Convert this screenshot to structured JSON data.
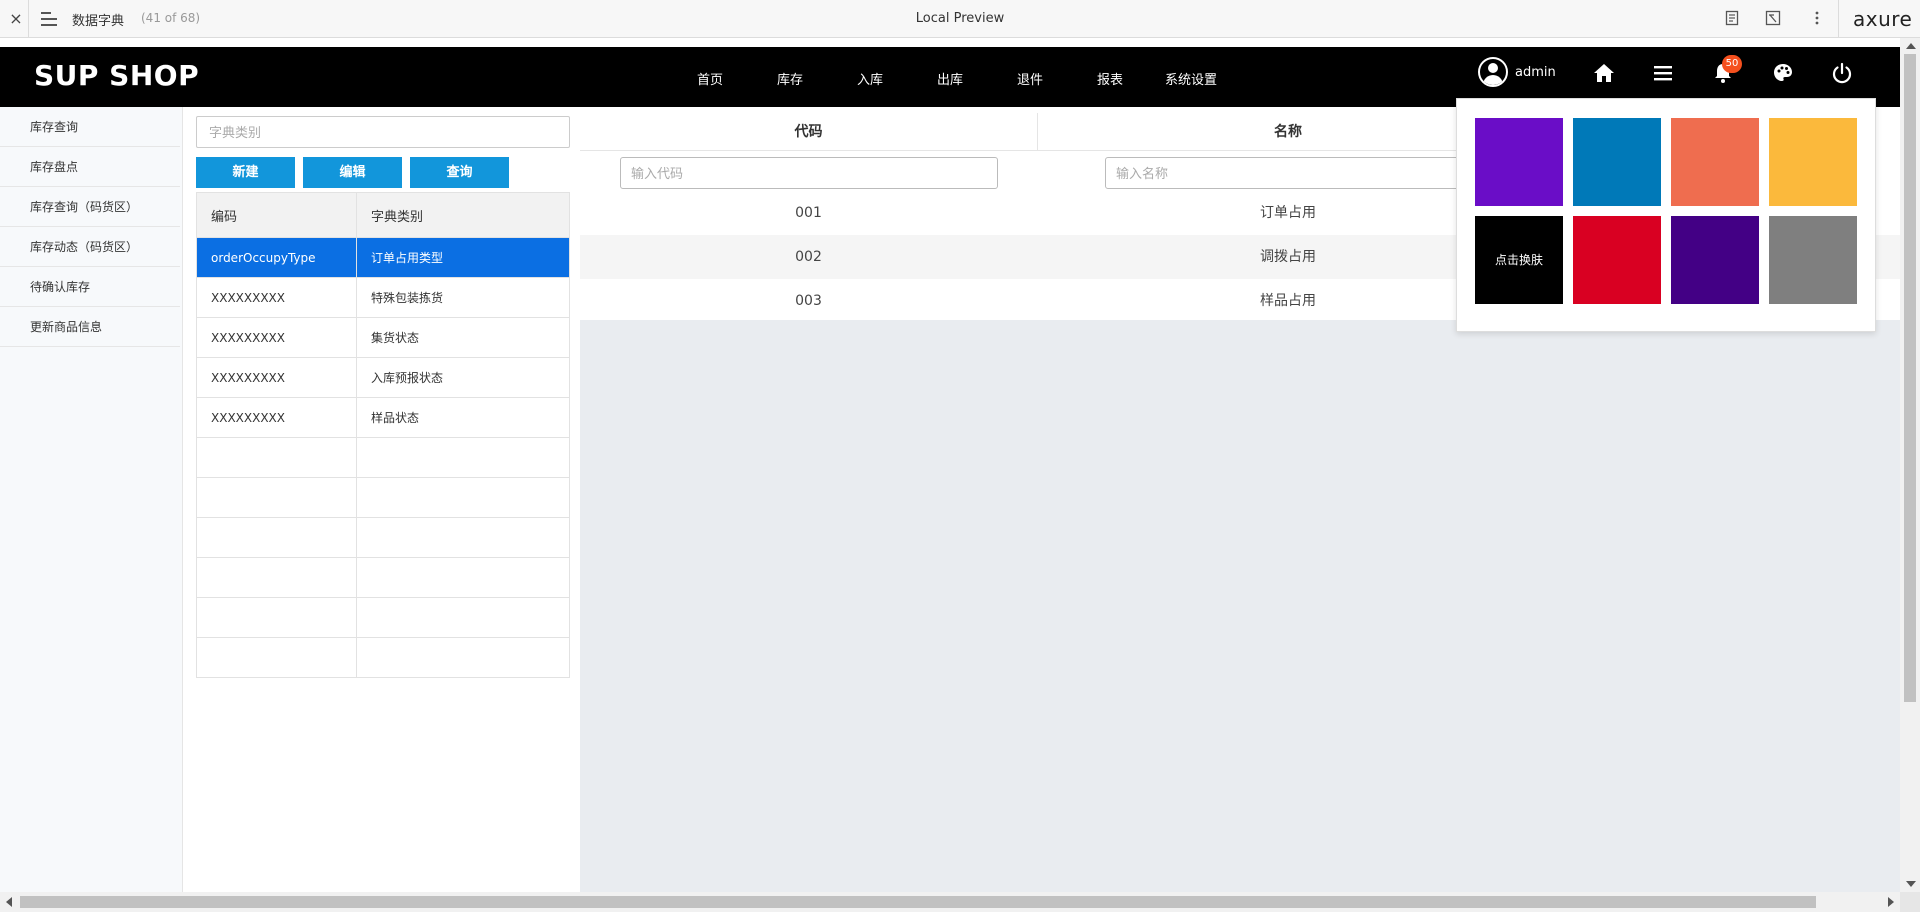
{
  "preview": {
    "close_glyph": "×",
    "page_name": "数据字典",
    "page_count": "(41 of 68)",
    "title": "Local Preview",
    "logo": "axure",
    "icons": [
      "notes-icon",
      "inspect-icon",
      "more-icon"
    ]
  },
  "header": {
    "logo": "SUP SHOP",
    "nav": [
      "首页",
      "库存",
      "入库",
      "出库",
      "退件",
      "报表",
      "系统设置"
    ],
    "user": "admin",
    "notification_count": "50",
    "badge_color": "#f5501e"
  },
  "sidebar": {
    "items": [
      "库存查询",
      "库存盘点",
      "库存查询（码货区）",
      "库存动态（码货区）",
      "待确认库存",
      "更新商品信息"
    ]
  },
  "category_panel": {
    "search_placeholder": "字典类别",
    "buttons": {
      "new": "新建",
      "edit": "编辑",
      "query": "查询"
    },
    "columns": [
      "编码",
      "字典类别"
    ],
    "rows": [
      {
        "code": "orderOccupyType",
        "type": "订单占用类型",
        "selected": true
      },
      {
        "code": "XXXXXXXXX",
        "type": "特殊包装拣货"
      },
      {
        "code": "XXXXXXXXX",
        "type": "集货状态"
      },
      {
        "code": "XXXXXXXXX",
        "type": "入库预报状态"
      },
      {
        "code": "XXXXXXXXX",
        "type": "样品状态"
      },
      {
        "code": "",
        "type": ""
      },
      {
        "code": "",
        "type": ""
      },
      {
        "code": "",
        "type": ""
      },
      {
        "code": "",
        "type": ""
      },
      {
        "code": "",
        "type": ""
      },
      {
        "code": "",
        "type": ""
      }
    ]
  },
  "dict_panel": {
    "columns": [
      "代码",
      "名称"
    ],
    "code_placeholder": "输入代码",
    "name_placeholder": "输入名称",
    "rows": [
      {
        "code": "001",
        "name": "订单占用"
      },
      {
        "code": "002",
        "name": "调拨占用"
      },
      {
        "code": "003",
        "name": "样品占用"
      }
    ]
  },
  "theme_panel": {
    "swatches": [
      {
        "color": "#6a0dc7",
        "label": ""
      },
      {
        "color": "#0079b8",
        "label": ""
      },
      {
        "color": "#ef6d4f",
        "label": ""
      },
      {
        "color": "#fbb93c",
        "label": ""
      },
      {
        "color": "#000000",
        "label": "点击换肤"
      },
      {
        "color": "#d90022",
        "label": ""
      },
      {
        "color": "#430085",
        "label": ""
      },
      {
        "color": "#7f7f7f",
        "label": ""
      }
    ]
  },
  "colors": {
    "primary_button": "#1296db",
    "selected_row": "#0b6fe3",
    "header_bg": "#000000"
  }
}
